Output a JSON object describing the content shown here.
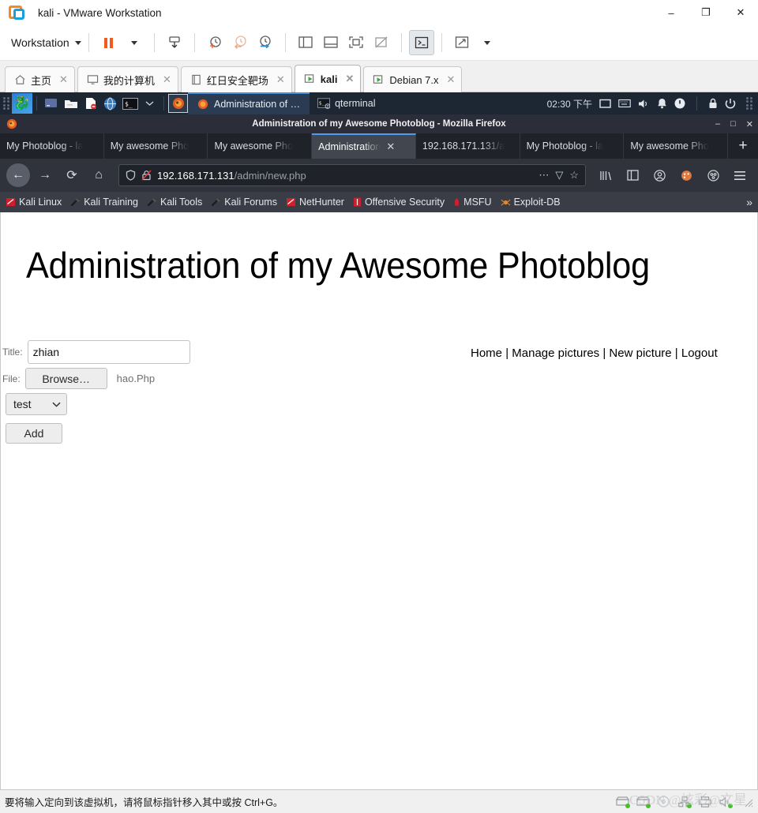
{
  "vmware": {
    "title": "kali - VMware Workstation",
    "logo_icon": "vmware-logo-icon",
    "window_controls": {
      "minimize": "–",
      "restore": "❐",
      "close": "✕"
    },
    "toolbar": {
      "menu_label": "Workstation",
      "buttons": [
        {
          "name": "suspend-button",
          "icon": "pause-icon"
        },
        {
          "name": "power-options-dropdown",
          "icon": "chevron-down-icon"
        },
        {
          "name": "send-ctrl-alt-del-button",
          "icon": "send-key-icon"
        },
        {
          "name": "take-snapshot-button",
          "icon": "snapshot-add-icon"
        },
        {
          "name": "revert-snapshot-button",
          "icon": "snapshot-revert-icon"
        },
        {
          "name": "snapshot-manager-button",
          "icon": "snapshot-manage-icon"
        },
        {
          "name": "show-library-button",
          "icon": "panel-left-icon"
        },
        {
          "name": "show-thumbnail-bar-button",
          "icon": "panel-bottom-icon"
        },
        {
          "name": "fullscreen-button",
          "icon": "fullscreen-icon"
        },
        {
          "name": "unity-mode-button",
          "icon": "unity-off-icon"
        },
        {
          "name": "console-view-button",
          "icon": "terminal-icon"
        },
        {
          "name": "stretch-guest-button",
          "icon": "expand-arrows-icon"
        },
        {
          "name": "stretch-dropdown",
          "icon": "chevron-down-icon"
        }
      ]
    },
    "tabs": [
      {
        "label": "主页",
        "icon": "home-icon",
        "selected": false,
        "closable": true
      },
      {
        "label": "我的计算机",
        "icon": "monitor-icon",
        "selected": false,
        "closable": true
      },
      {
        "label": "红日安全靶场",
        "icon": "folder-icon",
        "selected": false,
        "closable": true
      },
      {
        "label": "kali",
        "icon": "vm-icon",
        "selected": true,
        "closable": true
      },
      {
        "label": "Debian 7.x",
        "icon": "vm-icon",
        "selected": false,
        "closable": true
      }
    ],
    "status": {
      "message": "要将输入定向到该虚拟机，请将鼠标指针移入其中或按 Ctrl+G。",
      "icons": [
        "hard-disk-icon",
        "hard-disk-icon",
        "cd-dvd-icon",
        "network-icon",
        "printer-icon",
        "sound-icon"
      ],
      "watermark": "CSDN @炫彩@文星"
    }
  },
  "kali_taskbar": {
    "menu_icon": "kali-dragon-icon",
    "launchers": [
      {
        "name": "launcher-show-desktop",
        "icon": "desktop-icon"
      },
      {
        "name": "launcher-file-manager",
        "icon": "folder-icon"
      },
      {
        "name": "launcher-text-editor",
        "icon": "document-icon"
      },
      {
        "name": "launcher-browser",
        "icon": "globe-icon"
      },
      {
        "name": "launcher-terminal",
        "icon": "terminal-icon"
      },
      {
        "name": "launcher-more",
        "icon": "chevron-down-icon"
      },
      {
        "name": "launcher-firefox",
        "icon": "firefox-icon"
      }
    ],
    "windows": [
      {
        "label": "Administration of …",
        "icon": "firefox-icon",
        "active": true
      },
      {
        "label": "qterminal",
        "icon": "terminal-icon",
        "badge": "2",
        "active": false
      }
    ],
    "clock": "02:30 下午",
    "tray": [
      "display-icon",
      "keyboard-icon",
      "volume-icon",
      "notification-icon",
      "power-icon",
      "lock-icon",
      "logout-icon",
      "grip-icon"
    ]
  },
  "firefox": {
    "window_title": "Administration of my Awesome Photoblog - Mozilla Firefox",
    "window_controls": {
      "minimize": "–",
      "maximize": "□",
      "close": "✕"
    },
    "tabs": [
      {
        "label": "My Photoblog - la",
        "selected": false
      },
      {
        "label": "My awesome Pho",
        "selected": false
      },
      {
        "label": "My awesome Pho",
        "selected": false
      },
      {
        "label": "Administration",
        "selected": true
      },
      {
        "label": "192.168.171.131/a",
        "selected": false
      },
      {
        "label": "My Photoblog - la",
        "selected": false
      },
      {
        "label": "My awesome Pho",
        "selected": false
      }
    ],
    "new_tab_label": "+",
    "nav": {
      "back_icon": "arrow-left-icon",
      "forward_icon": "arrow-right-icon",
      "reload_icon": "reload-icon",
      "home_icon": "home-icon"
    },
    "urlbar": {
      "shield_icon": "shield-icon",
      "insecure_icon": "insecure-lock-icon",
      "host": "192.168.171.131",
      "path": "/admin/new.php",
      "page_actions_icon": "ellipsis-icon",
      "reader_icon": "reader-mode-icon",
      "bookmark_icon": "star-icon"
    },
    "toolbar_right": [
      "library-icon",
      "sidebar-icon",
      "account-icon",
      "palette-icon",
      "container-icon",
      "hamburger-menu-icon"
    ],
    "bookmarks": [
      {
        "label": "Kali Linux",
        "icon": "kali-icon"
      },
      {
        "label": "Kali Training",
        "icon": "kali-tool-icon"
      },
      {
        "label": "Kali Tools",
        "icon": "kali-tool-icon"
      },
      {
        "label": "Kali Forums",
        "icon": "kali-tool-icon"
      },
      {
        "label": "NetHunter",
        "icon": "kali-icon"
      },
      {
        "label": "Offensive Security",
        "icon": "offsec-icon"
      },
      {
        "label": "MSFU",
        "icon": "offsec-icon"
      },
      {
        "label": "Exploit-DB",
        "icon": "spider-icon"
      }
    ],
    "bookmarks_overflow": "»"
  },
  "page": {
    "heading": "Administration of my Awesome Photoblog",
    "nav_links": [
      {
        "label": "Home"
      },
      {
        "label": "Manage pictures"
      },
      {
        "label": "New picture"
      },
      {
        "label": "Logout"
      }
    ],
    "nav_separator": "|",
    "form": {
      "title_label": "Title:",
      "title_value": "zhian",
      "title_placeholder": "",
      "file_label": "File:",
      "browse_label": "Browse…",
      "file_name": "hao.Php",
      "category_value": "test",
      "category_caret": "chevron-down-icon",
      "submit_label": "Add"
    }
  }
}
